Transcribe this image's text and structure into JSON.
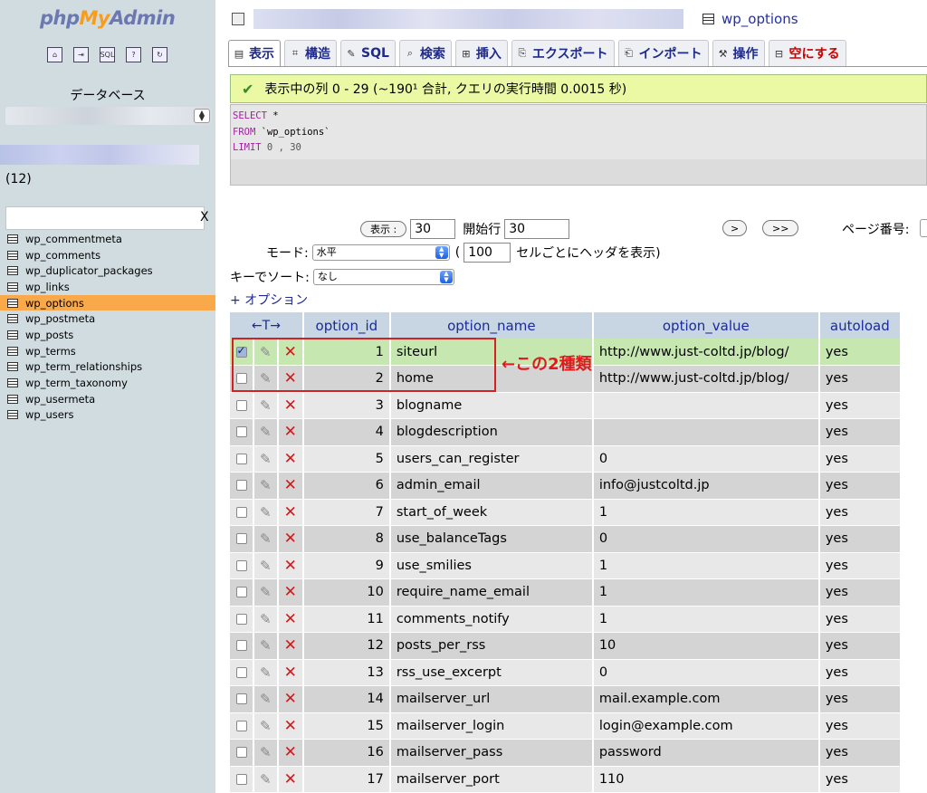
{
  "logo": {
    "php": "php",
    "my": "My",
    "admin": "Admin"
  },
  "nav_icons": [
    {
      "name": "home-icon",
      "glyph": "⌂"
    },
    {
      "name": "exit-icon",
      "glyph": "⇥"
    },
    {
      "name": "sql-window-icon",
      "glyph": "SQL"
    },
    {
      "name": "docs-icon",
      "glyph": "?"
    },
    {
      "name": "reload-icon",
      "glyph": "↻"
    }
  ],
  "sidebar": {
    "db_label": "データベース",
    "db_count": "(12)",
    "filter_clear": "X",
    "tables": [
      "wp_commentmeta",
      "wp_comments",
      "wp_duplicator_packages",
      "wp_links",
      "wp_options",
      "wp_postmeta",
      "wp_posts",
      "wp_terms",
      "wp_term_relationships",
      "wp_term_taxonomy",
      "wp_usermeta",
      "wp_users"
    ],
    "active_table": "wp_options"
  },
  "breadcrumb": {
    "table": "wp_options"
  },
  "tabs": [
    {
      "label": "表示",
      "icon": "▤"
    },
    {
      "label": "構造",
      "icon": "⌗"
    },
    {
      "label": "SQL",
      "icon": "✎"
    },
    {
      "label": "検索",
      "icon": "⌕"
    },
    {
      "label": "挿入",
      "icon": "⊞"
    },
    {
      "label": "エクスポート",
      "icon": "⎘"
    },
    {
      "label": "インポート",
      "icon": "⎗"
    },
    {
      "label": "操作",
      "icon": "⚒"
    },
    {
      "label": "空にする",
      "icon": "⊟"
    }
  ],
  "message": {
    "text": "表示中の列 0 - 29 (~190¹ 合計, クエリの実行時間 0.0015 秒)"
  },
  "sql": {
    "line1_kw": "SELECT",
    "line1_rest": " *",
    "line2_kw": "FROM",
    "line2_rest": " `wp_options`",
    "line3_kw": "LIMIT",
    "line3_rest": " 0 , 30"
  },
  "controls": {
    "show_button": "表示 :",
    "rows": "30",
    "start_label": "開始行",
    "start": "30",
    "next": ">",
    "last": ">>",
    "page_label": "ページ番号:",
    "mode_label": "モード:",
    "mode_value": "水平",
    "paren": "(",
    "repeat": "100",
    "repeat_suffix": "セルごとにヘッダを表示)",
    "sort_label": "キーでソート:",
    "sort_value": "なし",
    "options_link": "+ オプション"
  },
  "table": {
    "toggle_header": "←T→",
    "columns": [
      "option_id",
      "option_name",
      "option_value",
      "autoload"
    ],
    "rows": [
      {
        "id": "1",
        "name": "siteurl",
        "value": "http://www.just-coltd.jp/blog/",
        "autoload": "yes",
        "checked": true
      },
      {
        "id": "2",
        "name": "home",
        "value": "http://www.just-coltd.jp/blog/",
        "autoload": "yes",
        "checked": false
      },
      {
        "id": "3",
        "name": "blogname",
        "value": "",
        "autoload": "yes",
        "checked": false
      },
      {
        "id": "4",
        "name": "blogdescription",
        "value": "",
        "autoload": "yes",
        "checked": false
      },
      {
        "id": "5",
        "name": "users_can_register",
        "value": "0",
        "autoload": "yes",
        "checked": false
      },
      {
        "id": "6",
        "name": "admin_email",
        "value": "info@justcoltd.jp",
        "autoload": "yes",
        "checked": false
      },
      {
        "id": "7",
        "name": "start_of_week",
        "value": "1",
        "autoload": "yes",
        "checked": false
      },
      {
        "id": "8",
        "name": "use_balanceTags",
        "value": "0",
        "autoload": "yes",
        "checked": false
      },
      {
        "id": "9",
        "name": "use_smilies",
        "value": "1",
        "autoload": "yes",
        "checked": false
      },
      {
        "id": "10",
        "name": "require_name_email",
        "value": "1",
        "autoload": "yes",
        "checked": false
      },
      {
        "id": "11",
        "name": "comments_notify",
        "value": "1",
        "autoload": "yes",
        "checked": false
      },
      {
        "id": "12",
        "name": "posts_per_rss",
        "value": "10",
        "autoload": "yes",
        "checked": false
      },
      {
        "id": "13",
        "name": "rss_use_excerpt",
        "value": "0",
        "autoload": "yes",
        "checked": false
      },
      {
        "id": "14",
        "name": "mailserver_url",
        "value": "mail.example.com",
        "autoload": "yes",
        "checked": false
      },
      {
        "id": "15",
        "name": "mailserver_login",
        "value": "login@example.com",
        "autoload": "yes",
        "checked": false
      },
      {
        "id": "16",
        "name": "mailserver_pass",
        "value": "password",
        "autoload": "yes",
        "checked": false
      },
      {
        "id": "17",
        "name": "mailserver_port",
        "value": "110",
        "autoload": "yes",
        "checked": false
      }
    ]
  },
  "annotation": {
    "text": "←この2種類"
  }
}
